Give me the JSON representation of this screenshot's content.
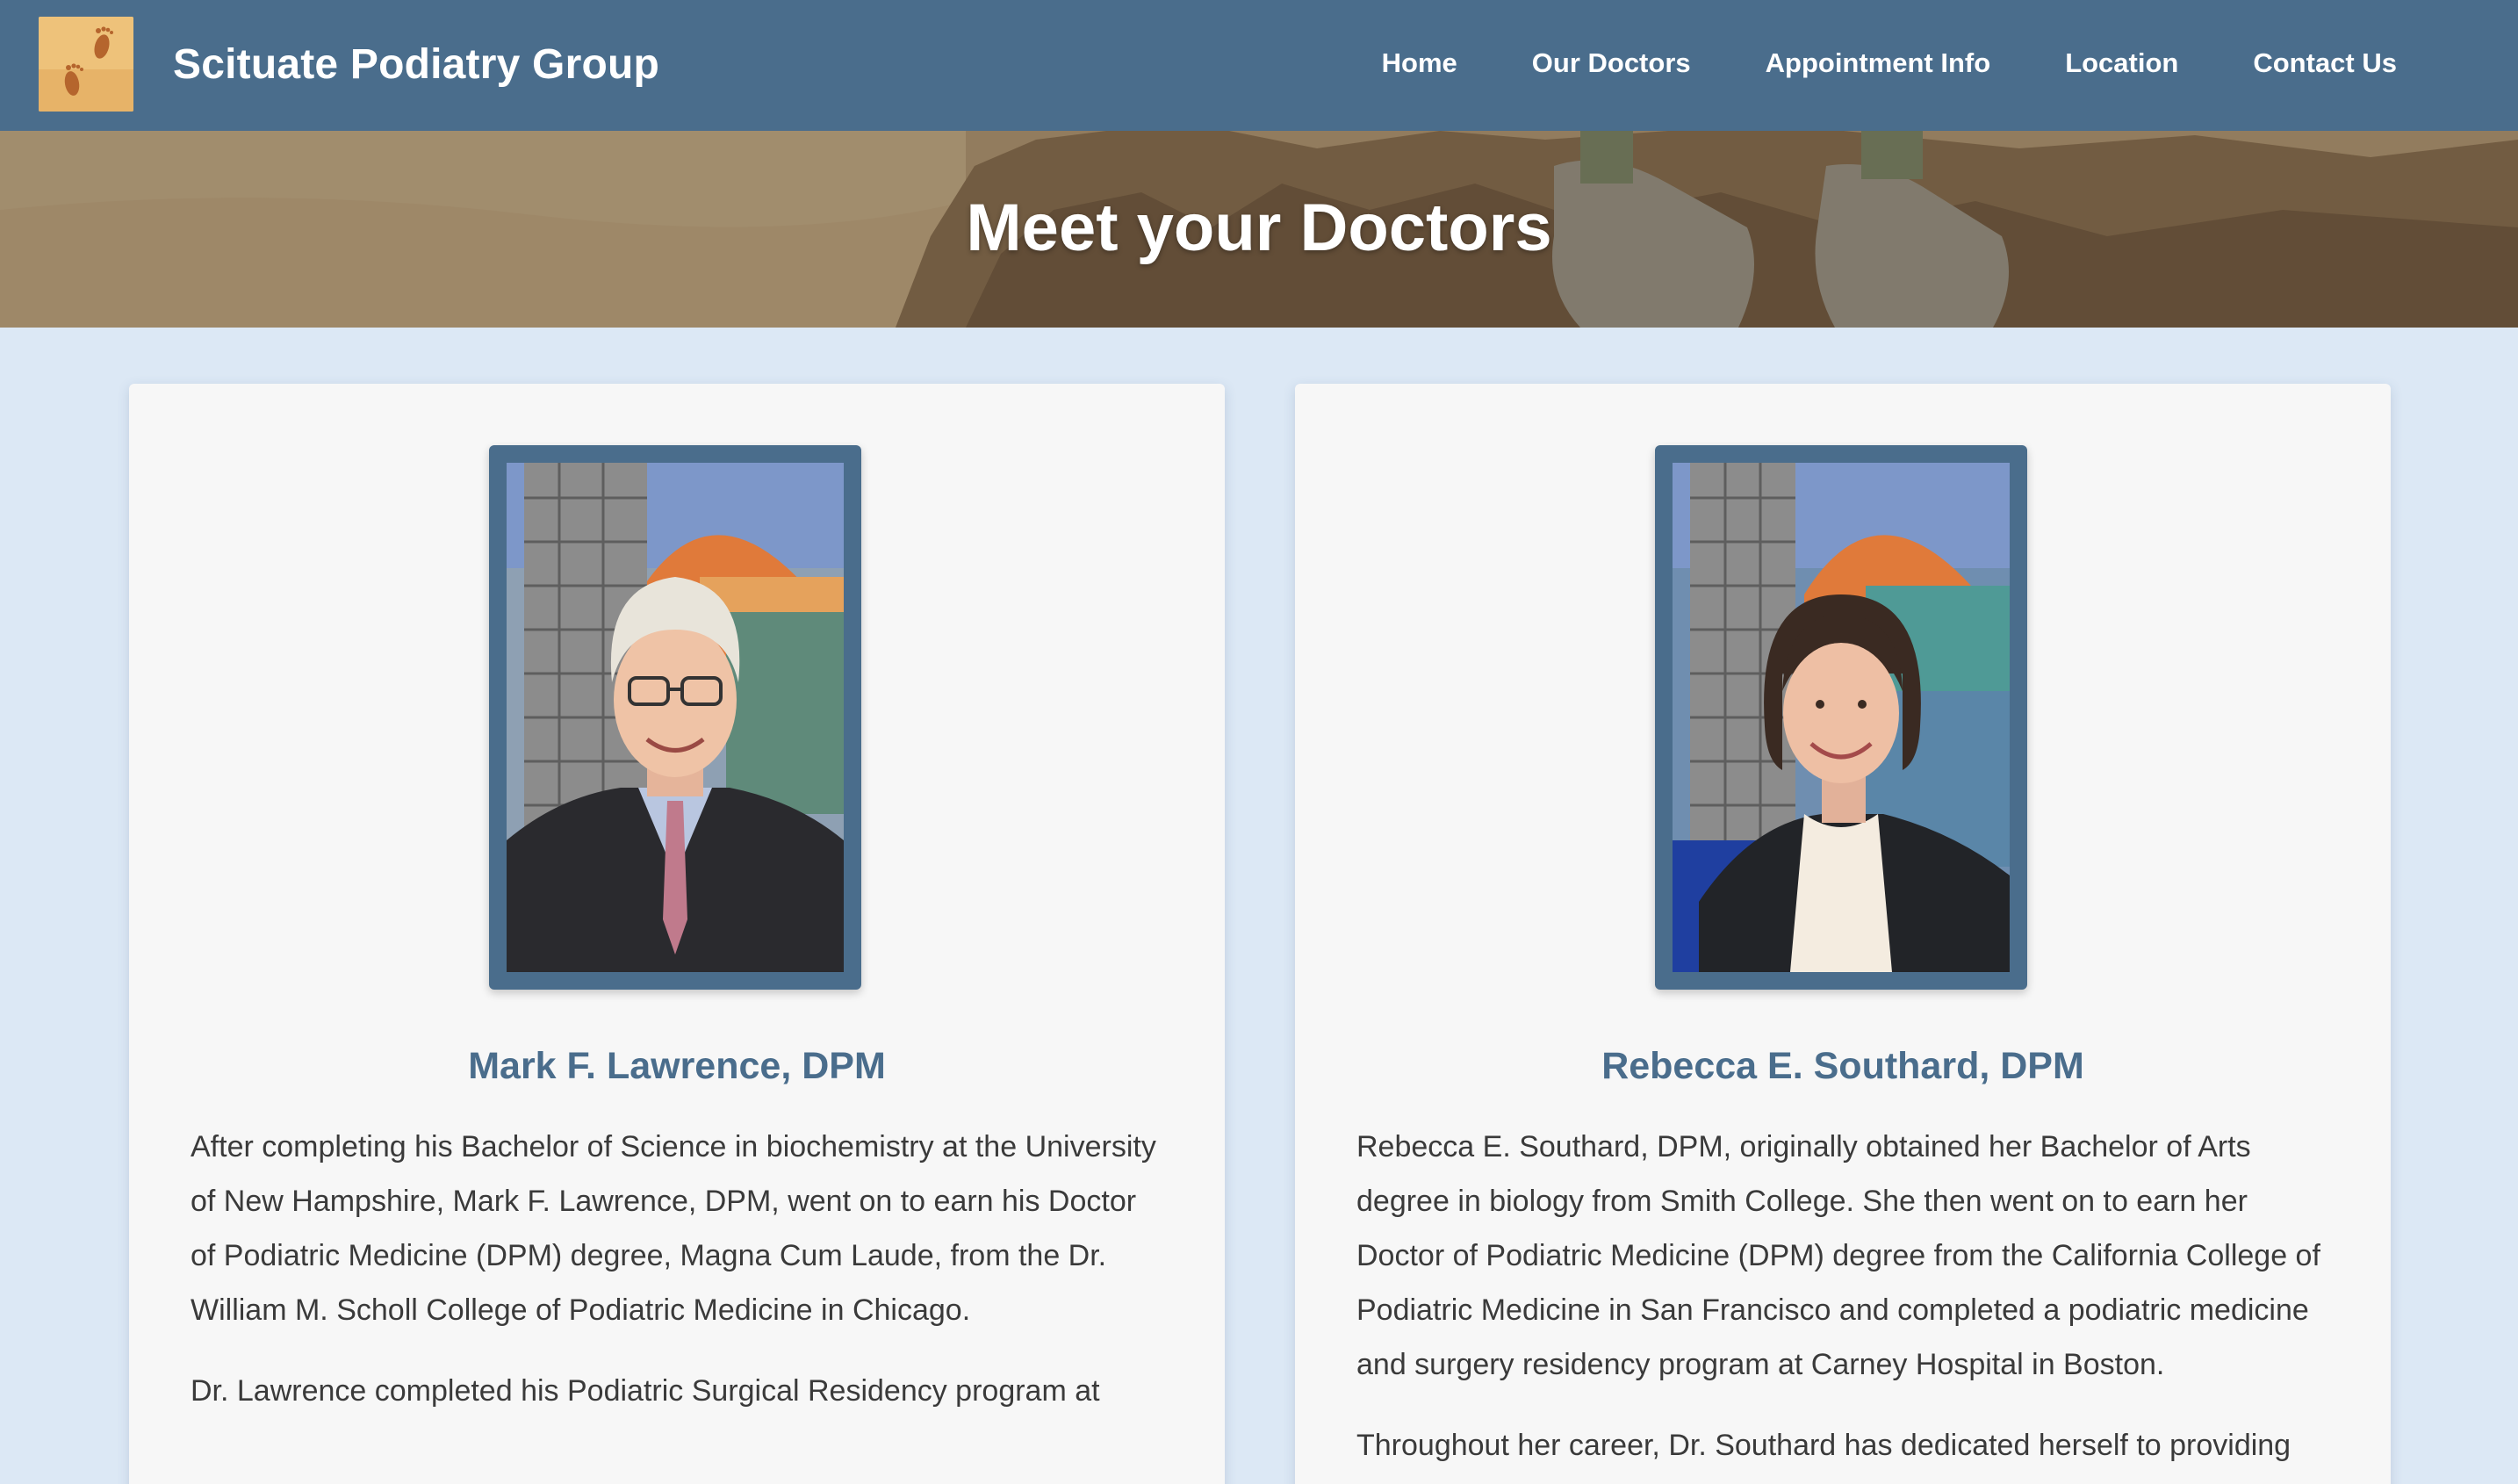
{
  "header": {
    "logo_icon": "footprints-logo-icon",
    "brand": "Scituate Podiatry Group",
    "nav": [
      {
        "label": "Home"
      },
      {
        "label": "Our Doctors"
      },
      {
        "label": "Appointment Info"
      },
      {
        "label": "Location"
      },
      {
        "label": "Contact Us"
      }
    ]
  },
  "hero": {
    "title": "Meet your Doctors"
  },
  "doctors": [
    {
      "name": "Mark F. Lawrence, DPM",
      "paragraphs": [
        "After completing his Bachelor of Science in biochemistry at the University of New Hampshire, Mark F. Lawrence, DPM, went on to earn his Doctor of Podiatric Medicine (DPM) degree, Magna Cum Laude, from the Dr. William M. Scholl College of Podiatric Medicine in Chicago.",
        "Dr. Lawrence completed his Podiatric Surgical Residency program at"
      ]
    },
    {
      "name": "Rebecca E. Southard, DPM",
      "paragraphs": [
        "Rebecca E. Southard, DPM, originally obtained her Bachelor of Arts degree in biology from Smith College. She then went on to earn her Doctor of Podiatric Medicine (DPM) degree from the California College of Podiatric Medicine in San Francisco and completed a podiatric medicine and surgery residency program at Carney Hospital in Boston.",
        "Throughout her career, Dr. Southard has dedicated herself to providing"
      ]
    }
  ],
  "colors": {
    "header_bg": "#4a6d8c",
    "page_bg": "#dce8f5",
    "card_bg": "#f7f7f7",
    "name_color": "#4a6d8c",
    "body_text": "#3a3a3a"
  }
}
